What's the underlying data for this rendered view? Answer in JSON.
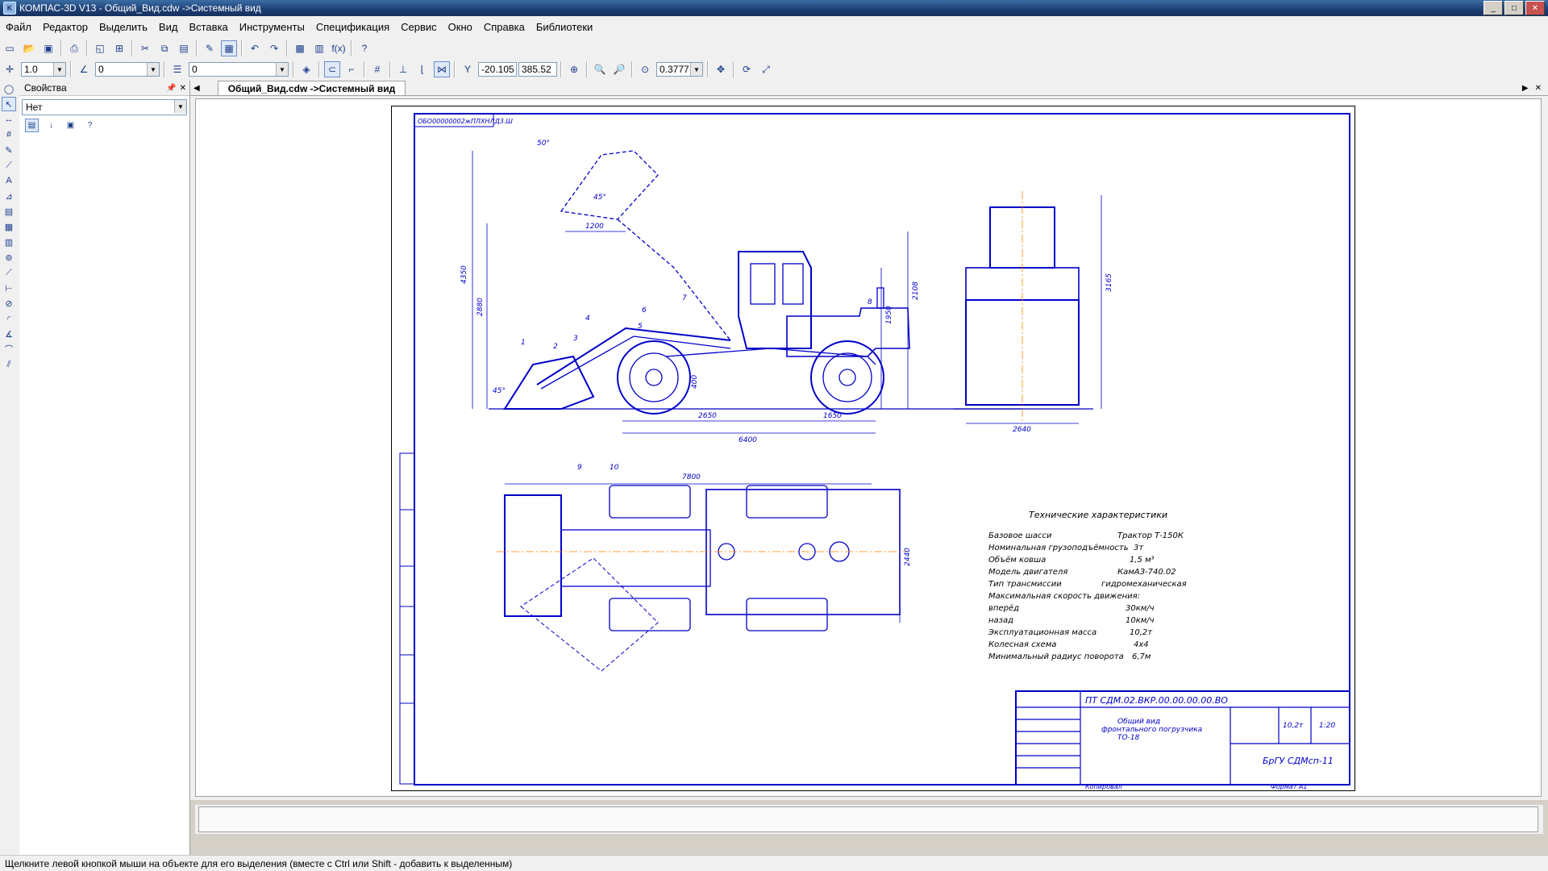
{
  "window": {
    "title": "КОМПАС-3D V13 - Общий_Вид.cdw ->Системный вид",
    "icon": "kompas-app-icon",
    "controls": [
      "minimize",
      "maximize",
      "close"
    ]
  },
  "menu": [
    "Файл",
    "Редактор",
    "Выделить",
    "Вид",
    "Вставка",
    "Инструменты",
    "Спецификация",
    "Сервис",
    "Окно",
    "Справка",
    "Библиотеки"
  ],
  "toolbar2": {
    "step": "1.0",
    "angle": "0",
    "layer": "0",
    "coord_x": "-20.105",
    "coord_y": "385.52",
    "zoom": "0.3777"
  },
  "properties": {
    "header": "Свойства",
    "selection": "Нет"
  },
  "document": {
    "tab": "Общий_Вид.cdw ->Системный вид"
  },
  "drawing": {
    "stamp_rotated": "ОБО00000002жПЛХНЛД3.Ш",
    "dims": {
      "total_length_top": "6400",
      "wheelbase": "2650",
      "rear_overhang": "1650",
      "height_max": "4350",
      "height_bucket": "2880",
      "height_cab": "2108",
      "height_body": "1950",
      "reach": "1200",
      "width_side": "2640",
      "height_side": "3165",
      "length_plan": "7800",
      "width_plan": "2440",
      "ground": "400",
      "angle_tip": "50°",
      "angle_dump": "45°",
      "angle_bucket": "45°"
    },
    "leaders": [
      "1",
      "2",
      "3",
      "4",
      "5",
      "6",
      "7",
      "8",
      "9",
      "10"
    ],
    "specs_title": "Технические характеристики",
    "specs": [
      {
        "label": "Базовое шасси",
        "value": "Трактор Т-150К"
      },
      {
        "label": "Номинальная грузоподъёмность",
        "value": "3т"
      },
      {
        "label": "Объём ковша",
        "value": "1,5 м³"
      },
      {
        "label": "Модель двигателя",
        "value": "КамАЗ-740.02"
      },
      {
        "label": "Тип трансмиссии",
        "value": "гидромеханическая"
      },
      {
        "label": "Максимальная скорость движения:",
        "value": ""
      },
      {
        "label": "вперёд",
        "value": "30км/ч"
      },
      {
        "label": "назад",
        "value": "10км/ч"
      },
      {
        "label": "Эксплуатационная масса",
        "value": "10,2т"
      },
      {
        "label": "Колесная схема",
        "value": "4х4"
      },
      {
        "label": "Минимальный радиус поворота",
        "value": "6,7м"
      }
    ],
    "title_block": {
      "designation": "ПТ СДМ.02.ВКР.00.00.00.00.ВО",
      "name_line1": "Общий вид",
      "name_line2": "фронтального погрузчика",
      "name_line3": "ТО-18",
      "mass": "10,2т",
      "scale": "1:20",
      "org": "БрГУ СДМсп-11",
      "copied": "Копировал",
      "format": "Формат А1"
    }
  },
  "command_line": "",
  "status": "Щелкните левой кнопкой мыши на объекте для его выделения (вместе с Ctrl или Shift - добавить к выделенным)"
}
